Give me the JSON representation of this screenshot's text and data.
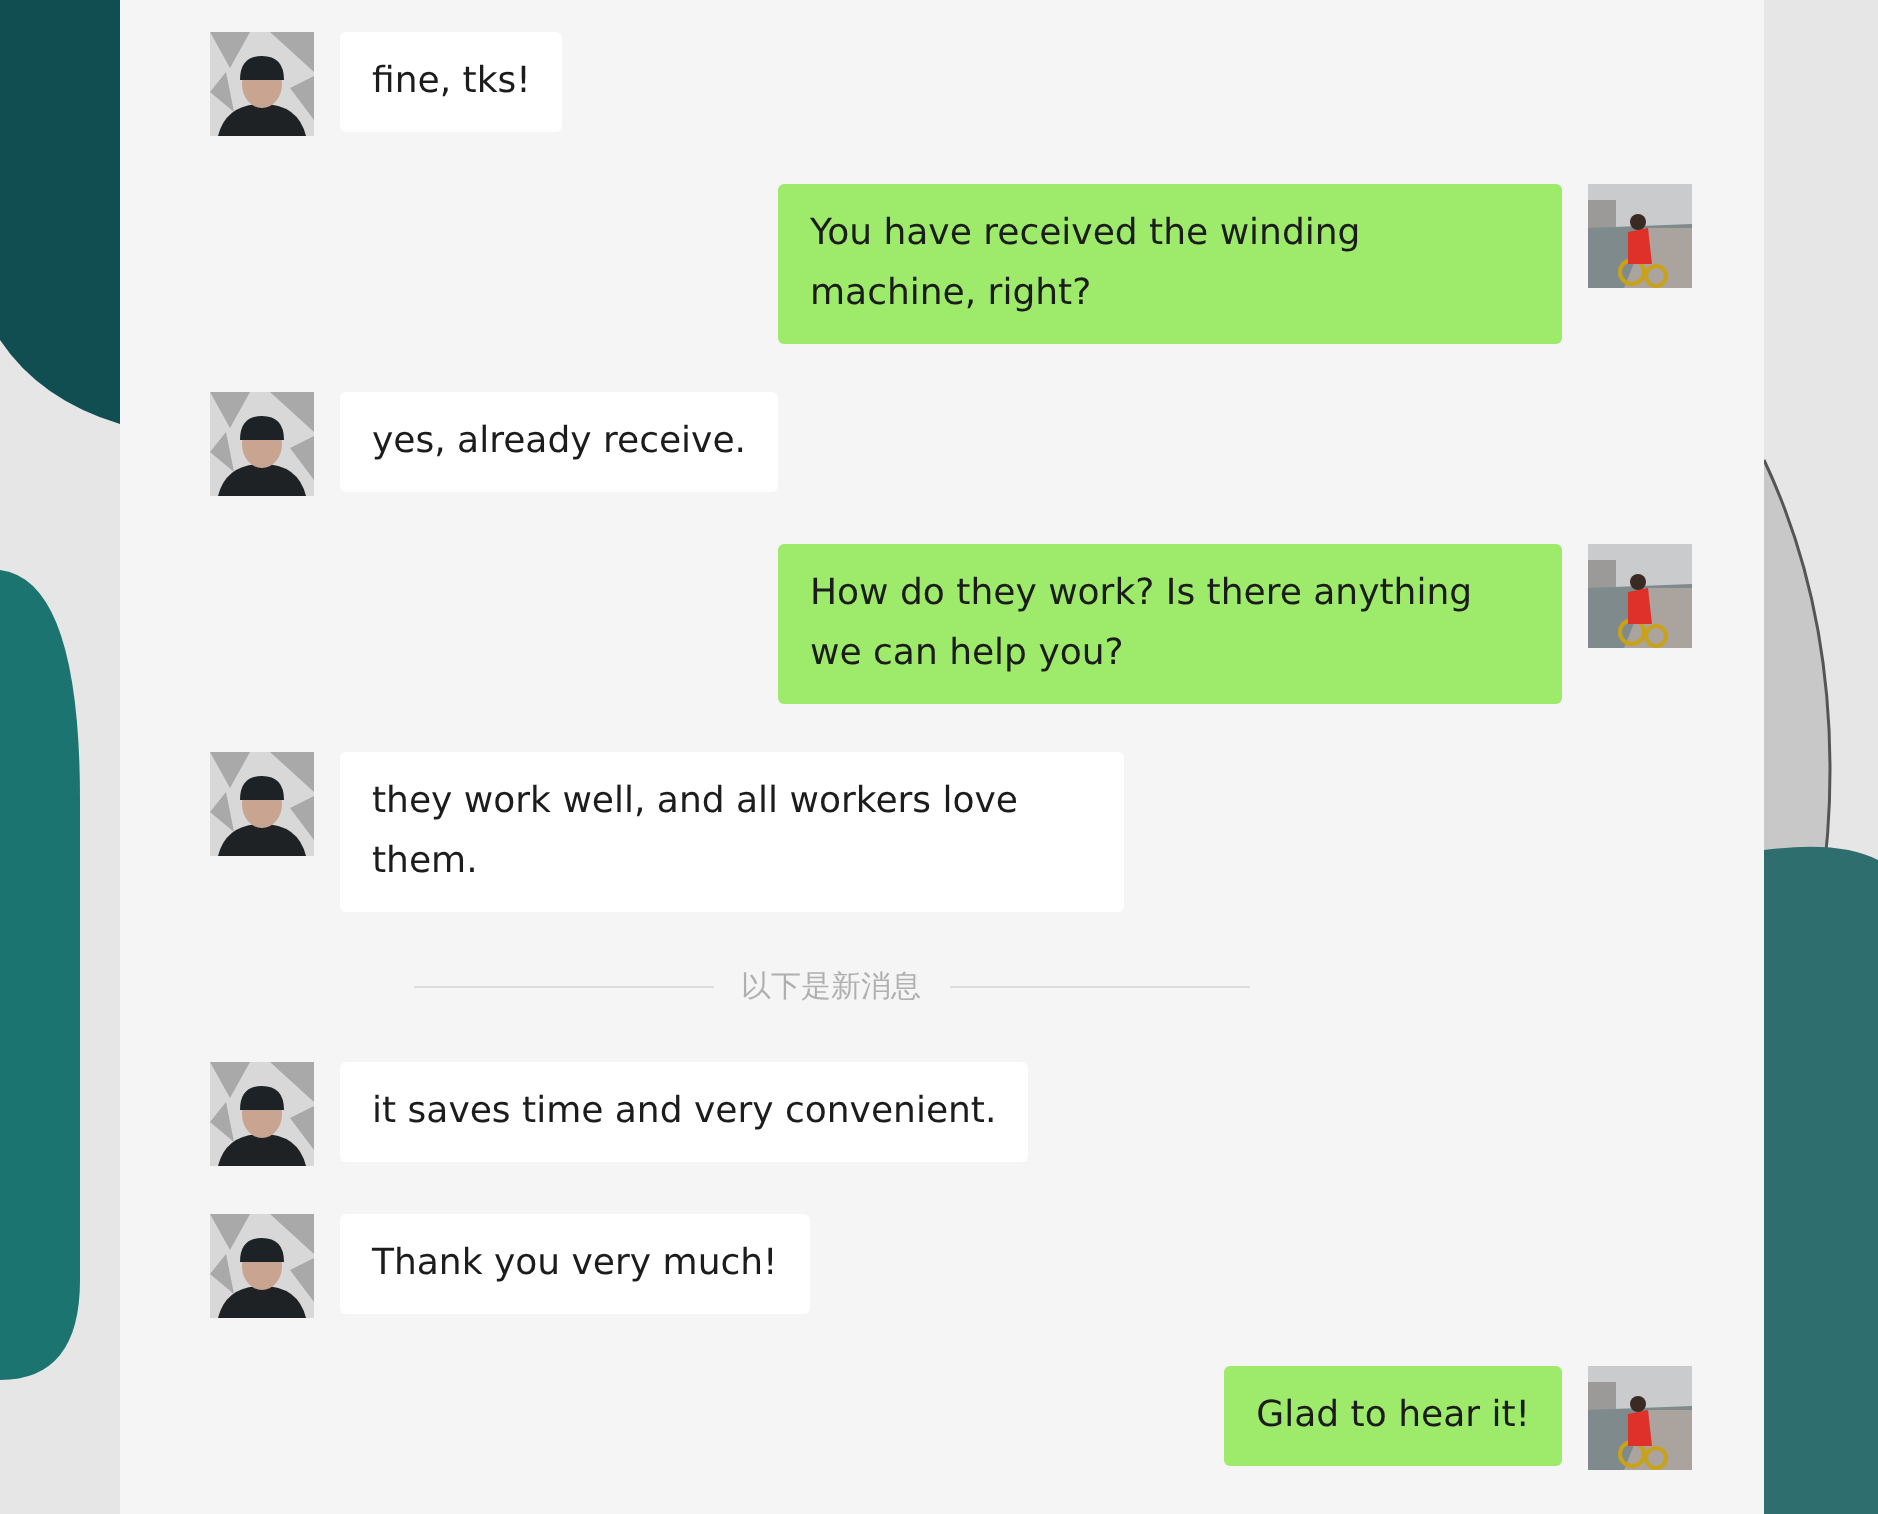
{
  "messages": [
    {
      "kind": "incoming",
      "text": "fine, tks!"
    },
    {
      "kind": "outgoing",
      "text": "You have received the winding machine, right?"
    },
    {
      "kind": "incoming",
      "text": "yes, already receive."
    },
    {
      "kind": "outgoing",
      "text": "How do they work? Is there anything we can help you?"
    },
    {
      "kind": "incoming",
      "text": "they work well, and all workers love them."
    },
    {
      "kind": "divider",
      "text": "以下是新消息"
    },
    {
      "kind": "incoming",
      "text": "it saves time and very convenient."
    },
    {
      "kind": "incoming",
      "text": "Thank you very much!"
    },
    {
      "kind": "outgoing",
      "text": "Glad to hear it!"
    }
  ]
}
